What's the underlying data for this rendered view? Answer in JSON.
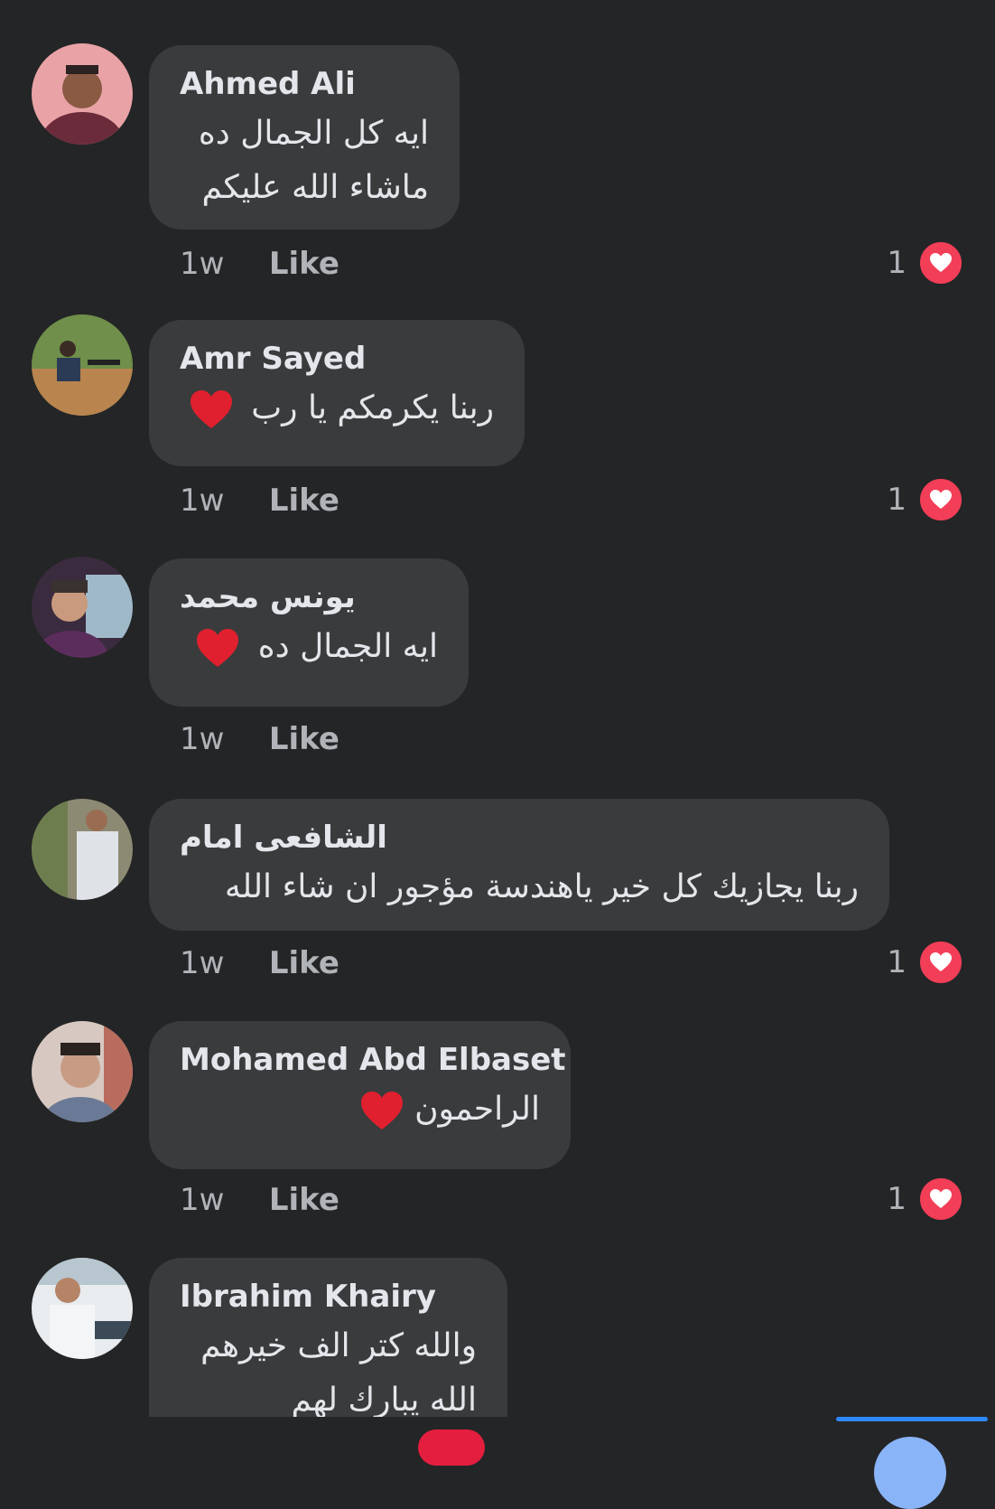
{
  "colors": {
    "background": "#242526",
    "bubble": "#3a3b3c",
    "reaction_love": "#f33e58",
    "accent_blue": "#2d88ff"
  },
  "comments": [
    {
      "author": "Ahmed Ali",
      "lines": [
        "ايه كل الجمال ده",
        "ماشاء الله عليكم"
      ],
      "time": "1w",
      "like_label": "Like",
      "reaction_count": "1"
    },
    {
      "author": "Amr Sayed",
      "lines": [
        "ربنا يكرمكم يا رب"
      ],
      "emoji": "red-heart",
      "time": "1w",
      "like_label": "Like",
      "reaction_count": "1"
    },
    {
      "author": "يونس محمد",
      "lines": [
        "ايه الجمال ده"
      ],
      "emoji": "red-heart",
      "time": "1w",
      "like_label": "Like"
    },
    {
      "author": "الشافعى امام",
      "lines": [
        "ربنا يجازيك كل خير ياهندسة مؤجور ان شاء الله"
      ],
      "time": "1w",
      "like_label": "Like",
      "reaction_count": "1"
    },
    {
      "author": "Mohamed Abd Elbaset",
      "lines": [
        "الراحمون"
      ],
      "emoji": "red-heart",
      "time": "1w",
      "like_label": "Like",
      "reaction_count": "1"
    },
    {
      "author": "Ibrahim Khairy",
      "lines": [
        "والله كتر الف خيرهم",
        "الله يبارك لهم"
      ]
    }
  ]
}
